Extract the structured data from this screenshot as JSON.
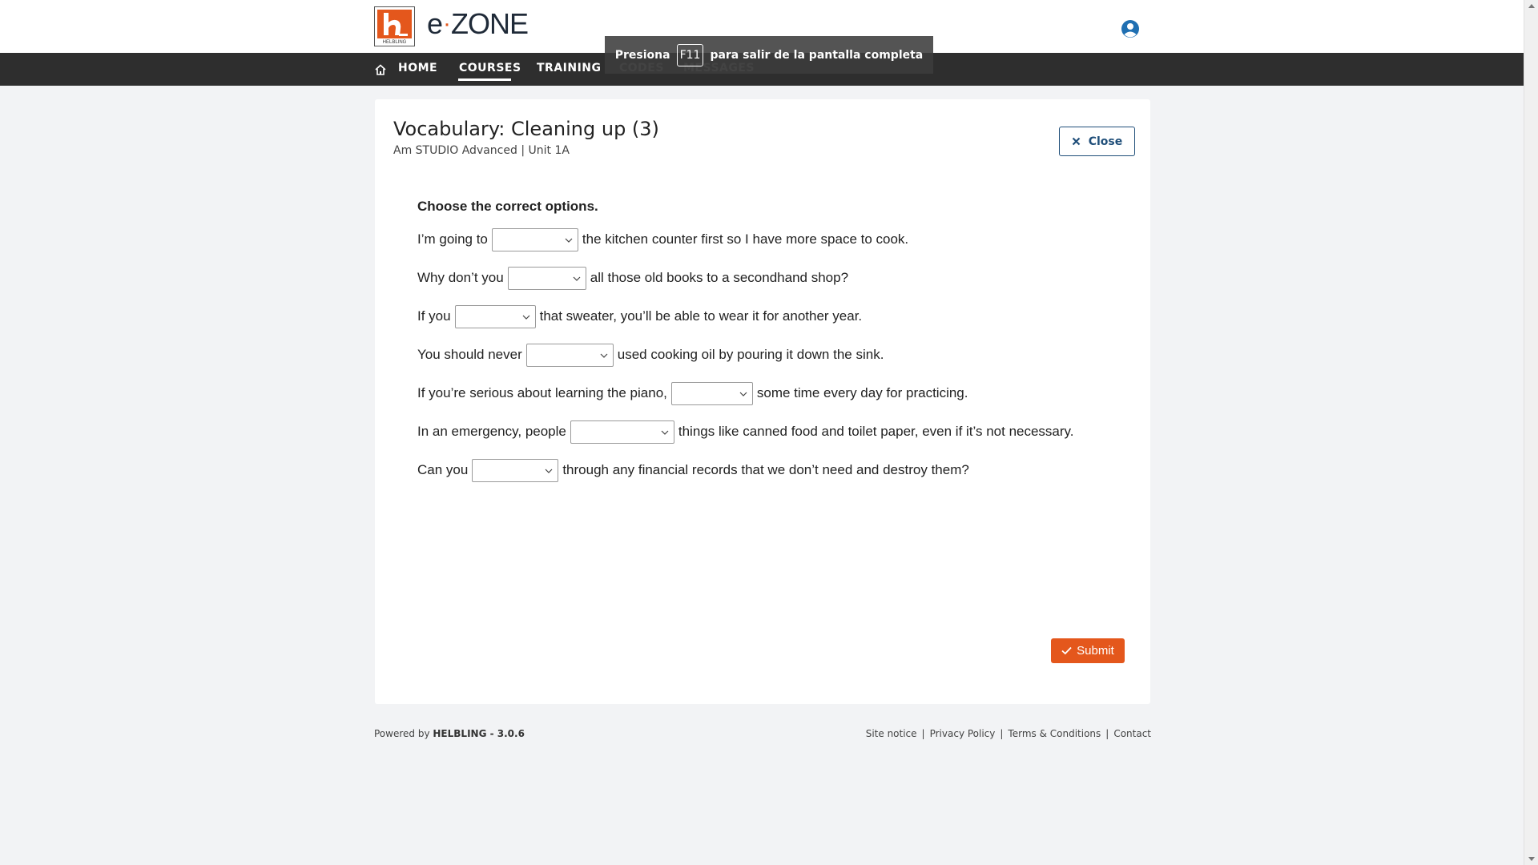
{
  "header": {
    "logo_text": "HELBLING",
    "brand_e": "e",
    "brand_zone": "ZONE"
  },
  "nav": {
    "items": [
      {
        "label": "HOME"
      },
      {
        "label": "COURSES"
      },
      {
        "label": "TRAINING"
      },
      {
        "label": "CODES"
      },
      {
        "label": "MESSAGES"
      }
    ],
    "active": "COURSES"
  },
  "toast": {
    "before": "Presiona",
    "key": "F11",
    "after": "para salir de la pantalla completa"
  },
  "exercise": {
    "title": "Vocabulary: Cleaning up (3)",
    "subtitle": "Am STUDIO Advanced | Unit 1A",
    "close_label": "Close",
    "instruction": "Choose the correct options.",
    "questions": [
      {
        "before": "I’m going to",
        "after": "the kitchen counter first so I have more space to cook.",
        "selected": ""
      },
      {
        "before": "Why don’t you",
        "after": "all those old books to a secondhand shop?",
        "selected": ""
      },
      {
        "before": "If you",
        "after": "that sweater, you’ll be able to wear it for another year.",
        "selected": ""
      },
      {
        "before": "You should never",
        "after": "used cooking oil by pouring it down the sink.",
        "selected": ""
      },
      {
        "before": "If you’re serious about learning the piano,",
        "after": "some time every day for practicing.",
        "selected": ""
      },
      {
        "before": "In an emergency, people",
        "after": "things like canned food and toilet paper, even if it’s not necessary.",
        "selected": ""
      },
      {
        "before": "Can you",
        "after": "through any financial records that we don’t need and destroy them?",
        "selected": ""
      }
    ],
    "submit_label": "Submit"
  },
  "footer": {
    "powered_prefix": "Powered by",
    "powered_brand": "HELBLING - 3.0.6",
    "links": [
      "Site notice",
      "Privacy Policy",
      "Terms & Conditions",
      "Contact"
    ]
  },
  "colors": {
    "accent": "#e4571c",
    "navbar": "#2e2e2e",
    "close_border": "#1f4e79",
    "user_icon": "#1f6fb2"
  },
  "icons": [
    "home-icon",
    "user-icon",
    "close-icon",
    "check-icon",
    "chevron-down-icon"
  ]
}
